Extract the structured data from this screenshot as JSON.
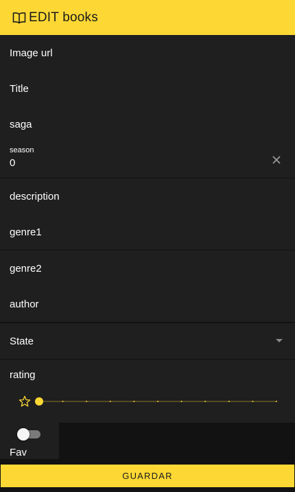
{
  "appbar": {
    "title": "EDIT books",
    "icon": "book-open-icon"
  },
  "form": {
    "image_url": {
      "label": "Image url"
    },
    "title": {
      "label": "Title"
    },
    "saga": {
      "label": "saga"
    },
    "season": {
      "label": "season",
      "value": "0"
    },
    "description": {
      "label": "description"
    },
    "genre1": {
      "label": "genre1"
    },
    "genre2": {
      "label": "genre2"
    },
    "author": {
      "label": "author"
    },
    "state": {
      "label": "State"
    },
    "rating": {
      "label": "rating",
      "value": 0,
      "min": 0,
      "max": 10,
      "steps": 10
    },
    "fav": {
      "label": "Fav",
      "checked": false
    }
  },
  "actions": {
    "save_label": "GUARDAR"
  },
  "colors": {
    "accent": "#fdd835",
    "surface": "#1f1f1f",
    "background": "#121212"
  }
}
